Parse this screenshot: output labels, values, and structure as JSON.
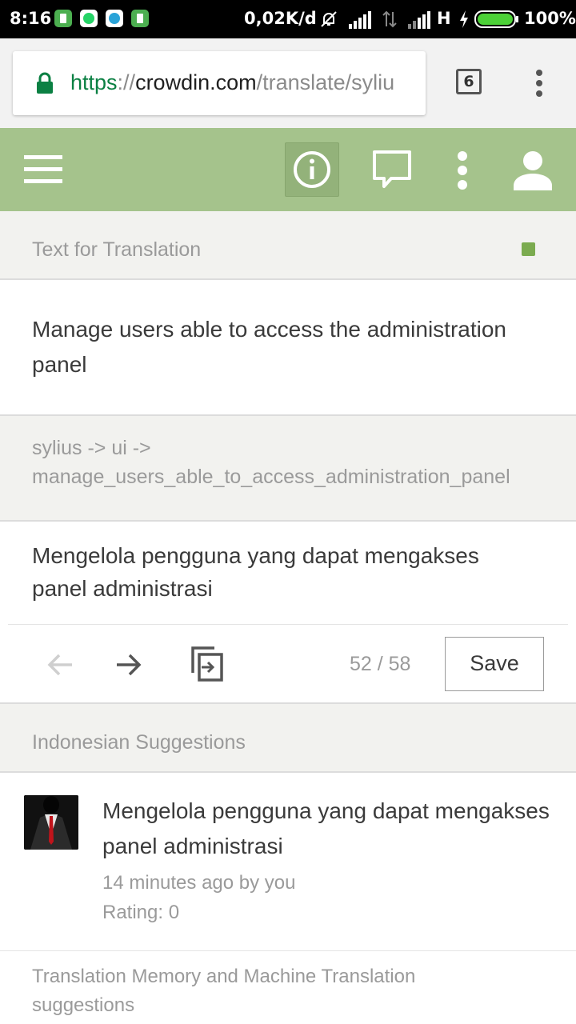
{
  "status_bar": {
    "time": "8:16",
    "net_rate": "0,02K/d",
    "network_type": "H",
    "battery": "100%",
    "icons": [
      "app-icon-green",
      "whatsapp-icon",
      "telegram-icon",
      "app-icon-green-2",
      "mute-icon",
      "signal-icon",
      "data-icon",
      "signal-icon-2",
      "charging-icon",
      "battery-icon"
    ]
  },
  "browser": {
    "url_scheme": "https",
    "url_sep": "://",
    "url_host": "crowdin.com",
    "url_path": "/translate/syliu",
    "tab_count": "6"
  },
  "appbar": {
    "icons": [
      "menu-icon",
      "info-icon",
      "comment-icon",
      "more-vert-icon",
      "user-icon"
    ],
    "accent": "#a5c38c"
  },
  "source": {
    "section_title": "Text for Translation",
    "status_color": "#7bab4f",
    "text": "Manage users able to access the administration panel",
    "key_line1": "sylius -> ui ->",
    "key_line2": "manage_users_able_to_access_administration_panel"
  },
  "translation": {
    "text": "Mengelola pengguna yang dapat mengakses panel administrasi",
    "counter": "52 / 58",
    "save_label": "Save"
  },
  "suggestions": {
    "section_title": "Indonesian Suggestions",
    "items": [
      {
        "text": "Mengelola pengguna yang dapat mengakses panel administrasi",
        "meta": "14 minutes ago by you",
        "rating": "Rating: 0"
      }
    ]
  },
  "tm": {
    "section_title": "Translation Memory and Machine Translation suggestions"
  }
}
